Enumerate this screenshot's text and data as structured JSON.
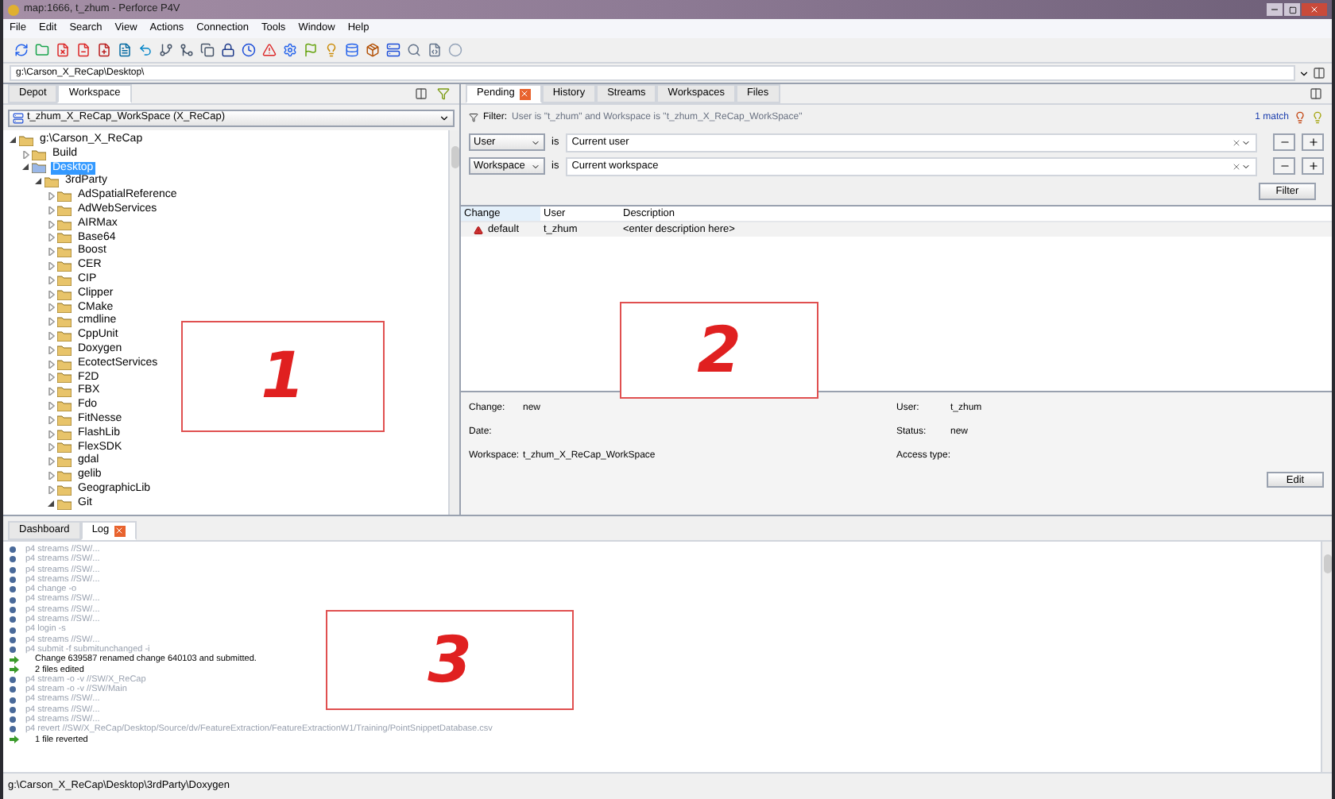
{
  "window": {
    "title": "map:1666, t_zhum - Perforce P4V"
  },
  "menu": [
    "File",
    "Edit",
    "Search",
    "View",
    "Actions",
    "Connection",
    "Tools",
    "Window",
    "Help"
  ],
  "path_bar": {
    "value": "g:\\Carson_X_ReCap\\Desktop\\"
  },
  "left_pane": {
    "tabs": [
      {
        "label": "Depot",
        "selected": false
      },
      {
        "label": "Workspace",
        "selected": true
      }
    ],
    "workspace_dropdown": "t_zhum_X_ReCap_WorkSpace (X_ReCap)",
    "tree": [
      {
        "label": "g:\\Carson_X_ReCap",
        "expanded": true,
        "selected": false,
        "children": [
          {
            "label": "Build",
            "expanded": false,
            "selected": false
          },
          {
            "label": "Desktop",
            "expanded": true,
            "selected": true,
            "children": [
              {
                "label": "3rdParty",
                "expanded": true,
                "selected": false,
                "children": [
                  {
                    "label": "AdSpatialReference",
                    "expanded": false,
                    "selected": false
                  },
                  {
                    "label": "AdWebServices",
                    "expanded": false,
                    "selected": false
                  },
                  {
                    "label": "AIRMax",
                    "expanded": false,
                    "selected": false
                  },
                  {
                    "label": "Base64",
                    "expanded": false,
                    "selected": false
                  },
                  {
                    "label": "Boost",
                    "expanded": false,
                    "selected": false
                  },
                  {
                    "label": "CER",
                    "expanded": false,
                    "selected": false
                  },
                  {
                    "label": "CIP",
                    "expanded": false,
                    "selected": false
                  },
                  {
                    "label": "Clipper",
                    "expanded": false,
                    "selected": false
                  },
                  {
                    "label": "CMake",
                    "expanded": false,
                    "selected": false
                  },
                  {
                    "label": "cmdline",
                    "expanded": false,
                    "selected": false
                  },
                  {
                    "label": "CppUnit",
                    "expanded": false,
                    "selected": false
                  },
                  {
                    "label": "Doxygen",
                    "expanded": false,
                    "selected": false
                  },
                  {
                    "label": "EcotectServices",
                    "expanded": false,
                    "selected": false
                  },
                  {
                    "label": "F2D",
                    "expanded": false,
                    "selected": false
                  },
                  {
                    "label": "FBX",
                    "expanded": false,
                    "selected": false
                  },
                  {
                    "label": "Fdo",
                    "expanded": false,
                    "selected": false
                  },
                  {
                    "label": "FitNesse",
                    "expanded": false,
                    "selected": false
                  },
                  {
                    "label": "FlashLib",
                    "expanded": false,
                    "selected": false
                  },
                  {
                    "label": "FlexSDK",
                    "expanded": false,
                    "selected": false
                  },
                  {
                    "label": "gdal",
                    "expanded": false,
                    "selected": false
                  },
                  {
                    "label": "gelib",
                    "expanded": false,
                    "selected": false
                  },
                  {
                    "label": "GeographicLib",
                    "expanded": false,
                    "selected": false
                  },
                  {
                    "label": "Git",
                    "expanded": true,
                    "selected": false
                  }
                ]
              }
            ]
          }
        ]
      }
    ]
  },
  "right_pane": {
    "tabs": [
      {
        "label": "Pending",
        "selected": true,
        "closable": true
      },
      {
        "label": "History",
        "selected": false,
        "closable": false
      },
      {
        "label": "Streams",
        "selected": false,
        "closable": false
      },
      {
        "label": "Workspaces",
        "selected": false,
        "closable": false
      },
      {
        "label": "Files",
        "selected": false,
        "closable": false
      }
    ],
    "filter_label": "Filter:",
    "filter_summary": "User is \"t_zhum\" and Workspace is \"t_zhum_X_ReCap_WorkSpace\"",
    "match_count": "1 match",
    "filter_rows": [
      {
        "field": "User",
        "operator": "is",
        "value": "Current user"
      },
      {
        "field": "Workspace",
        "operator": "is",
        "value": "Current workspace"
      }
    ],
    "filter_button": "Filter",
    "table": {
      "columns": [
        "Change",
        "User",
        "Description"
      ],
      "rows": [
        {
          "cells": [
            "default",
            "t_zhum",
            "<enter description here>"
          ]
        }
      ]
    },
    "details": [
      {
        "label": "Change:",
        "value": "new"
      },
      {
        "label": "User:",
        "value": "t_zhum"
      },
      {
        "label": "Date:"
      },
      {
        "label": "Status:",
        "value": "new"
      },
      {
        "label": "Workspace:",
        "value": "t_zhum_X_ReCap_WorkSpace"
      },
      {
        "label": "Access type:"
      }
    ],
    "edit_button": "Edit"
  },
  "bottom_tabs": [
    {
      "label": "Dashboard",
      "selected": false,
      "closable": false
    },
    {
      "label": "Log",
      "selected": true,
      "closable": true
    }
  ],
  "log": [
    {
      "kind": "command",
      "text": "p4 streams //SW/..."
    },
    {
      "kind": "command",
      "text": "p4 streams //SW/..."
    },
    {
      "kind": "command",
      "text": "p4 streams //SW/..."
    },
    {
      "kind": "command",
      "text": "p4 streams //SW/..."
    },
    {
      "kind": "command",
      "text": "p4 change -o"
    },
    {
      "kind": "command",
      "text": "p4 streams //SW/..."
    },
    {
      "kind": "command",
      "text": "p4 streams //SW/..."
    },
    {
      "kind": "command",
      "text": "p4 streams //SW/..."
    },
    {
      "kind": "command",
      "text": "p4 login -s"
    },
    {
      "kind": "command",
      "text": "p4 streams //SW/..."
    },
    {
      "kind": "command",
      "text": "p4 submit -f submitunchanged -i"
    },
    {
      "kind": "result",
      "text": "Change 639587 renamed change 640103 and submitted."
    },
    {
      "kind": "result",
      "text": "2 files edited"
    },
    {
      "kind": "command",
      "text": "p4 stream -o -v //SW/X_ReCap"
    },
    {
      "kind": "command",
      "text": "p4 stream -o -v //SW/Main"
    },
    {
      "kind": "command",
      "text": "p4 streams //SW/..."
    },
    {
      "kind": "command",
      "text": "p4 streams //SW/..."
    },
    {
      "kind": "command",
      "text": "p4 streams //SW/..."
    },
    {
      "kind": "command",
      "text": "p4 revert //SW/X_ReCap/Desktop/Source/dv/FeatureExtraction/FeatureExtractionW1/Training/PointSnippetDatabase.csv"
    },
    {
      "kind": "result",
      "text": "1 file reverted"
    }
  ],
  "status_bar": "g:\\Carson_X_ReCap\\Desktop\\3rdParty\\Doxygen",
  "annotations": [
    {
      "label": "1"
    },
    {
      "label": "2"
    },
    {
      "label": "3"
    }
  ]
}
